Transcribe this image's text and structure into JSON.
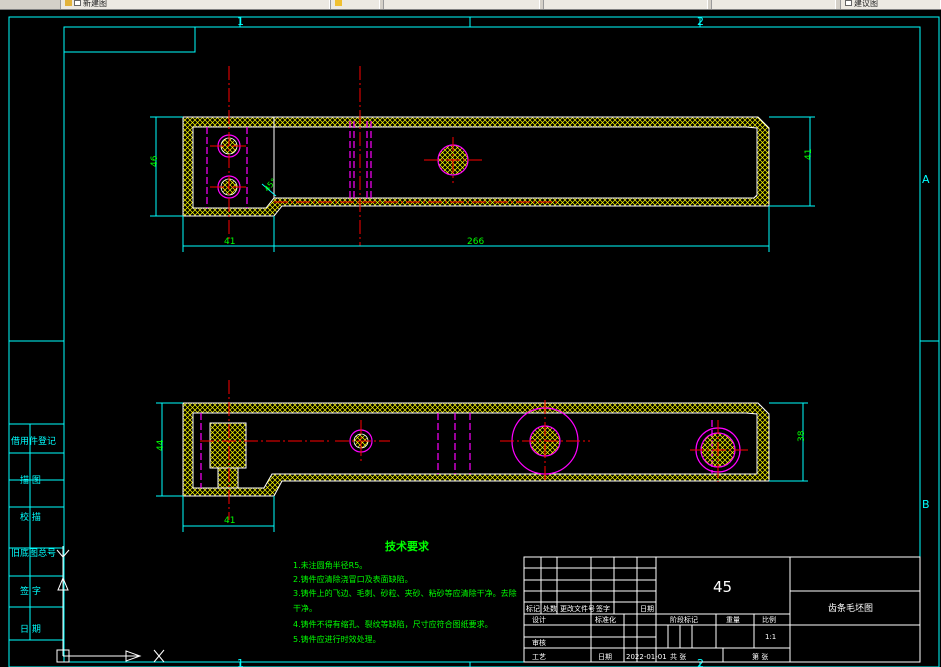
{
  "window": {
    "tabs": [
      {
        "label": "新建图"
      },
      {
        "label": ""
      },
      {
        "label": ""
      },
      {
        "label": ""
      },
      {
        "label": ""
      },
      {
        "label": "建议图"
      }
    ]
  },
  "colors": {
    "frame": "#00ffff",
    "outline": "#ffffff",
    "hatch": "#ffff00",
    "center_line": "#ff0000",
    "hidden_line": "#ff00ff",
    "dimension": "#00ff00",
    "background": "#000000"
  },
  "drawing": {
    "zone_numbers": [
      "1",
      "2"
    ],
    "zone_letters": [
      "A",
      "B"
    ],
    "view_top": {
      "dim_height_left": "46",
      "dim_height_right": "41",
      "dim_length_left": "41",
      "dim_length_total": "266",
      "chamfer_label": "45°"
    },
    "view_front": {
      "dim_height_left": "44",
      "dim_height_right": "38",
      "dim_length_left": "41"
    },
    "tech_requirements": {
      "title": "技术要求",
      "lines": [
        "1.未注圆角半径R5。",
        "2.铸件应清除浇冒口及表面缺陷。",
        "3.铸件上的飞边、毛刺、砂粒、夹砂、粘砂等应清除干净。去除",
        "干净。",
        "4.铸件不得有缩孔、裂纹等缺陷，尺寸应符合图纸要求。",
        "5.铸件应进行时效处理。"
      ]
    },
    "side_labels": [
      "借用件登记",
      "描 图",
      "校 描",
      "旧底图总号",
      "签 字",
      "日 期"
    ],
    "title_block": {
      "material": "45",
      "part_name": "齿条毛坯图",
      "scale": "1:1",
      "date": "2022-01-01",
      "row_labels_bottom": [
        "标记",
        "处数",
        "更改文件号",
        "签字",
        "日期"
      ],
      "design_label": "设计",
      "standardization_label": "标准化",
      "review_label": "审核",
      "process_label": "工艺",
      "date_label": "日期",
      "stage_mark_label": "阶段标记",
      "weight_label": "重量",
      "scale_label": "比例",
      "sheet_total_label": "共 张",
      "sheet_no_label": "第 张"
    }
  }
}
